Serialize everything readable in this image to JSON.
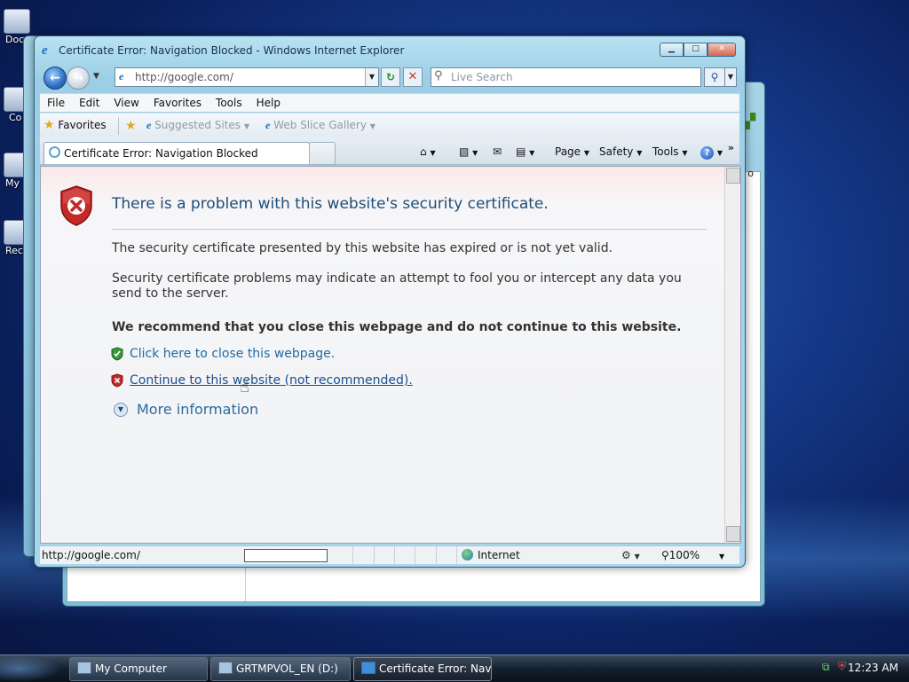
{
  "desktop": {
    "icons": [
      {
        "label": "Doc",
        "name": "documents"
      },
      {
        "label": "Co",
        "name": "computer"
      },
      {
        "label": "My",
        "name": "my-network"
      },
      {
        "label": "Rec",
        "name": "recycle-bin"
      }
    ],
    "back_window": {
      "column_header": "o"
    }
  },
  "ie": {
    "title": "Certificate Error: Navigation Blocked - Windows Internet Explorer",
    "address": "http://google.com/",
    "search_placeholder": "Live Search",
    "menu": [
      "File",
      "Edit",
      "View",
      "Favorites",
      "Tools",
      "Help"
    ],
    "favorites_label": "Favorites",
    "fav_links": [
      "Suggested Sites",
      "Web Slice Gallery"
    ],
    "tab_title": "Certificate Error: Navigation Blocked",
    "commands": {
      "page": "Page",
      "safety": "Safety",
      "tools": "Tools"
    },
    "status": {
      "url": "http://google.com/",
      "zone": "Internet",
      "zoom": "100%"
    }
  },
  "page": {
    "heading": "There is a problem with this website's security certificate.",
    "p1": "The security certificate presented by this website has expired or is not yet valid.",
    "p2": "Security certificate problems may indicate an attempt to fool you or intercept any data you send to the server.",
    "p3": "We recommend that you close this webpage and do not continue to this website.",
    "link_close": "Click here to close this webpage.",
    "link_continue": "Continue to this website (not recommended).",
    "more_info": "More information"
  },
  "taskbar": {
    "items": [
      {
        "label": "My Computer",
        "active": false
      },
      {
        "label": "GRTMPVOL_EN (D:)",
        "active": false
      },
      {
        "label": "Certificate Error: Navi...",
        "active": true
      }
    ],
    "clock": "12:23 AM"
  },
  "colors": {
    "heading": "#1f4e78",
    "link": "#1f6aa4",
    "shield_red": "#c0392b",
    "shield_green": "#3a9a3a"
  }
}
